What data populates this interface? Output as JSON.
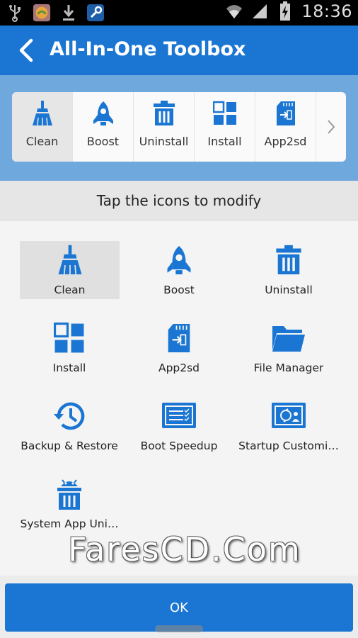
{
  "status_bar": {
    "time": "18:36"
  },
  "app_bar": {
    "title": "All-In-One Toolbox"
  },
  "toolbar_strip": [
    {
      "label": "Clean",
      "icon": "broom-icon"
    },
    {
      "label": "Boost",
      "icon": "rocket-icon"
    },
    {
      "label": "Uninstall",
      "icon": "trash-icon"
    },
    {
      "label": "Install",
      "icon": "apps-grid-icon"
    },
    {
      "label": "App2sd",
      "icon": "sd-card-icon"
    }
  ],
  "hint": "Tap the icons to modify",
  "tools": [
    {
      "label": "Clean",
      "icon": "broom-icon"
    },
    {
      "label": "Boost",
      "icon": "rocket-icon"
    },
    {
      "label": "Uninstall",
      "icon": "trash-icon"
    },
    {
      "label": "Install",
      "icon": "apps-grid-icon"
    },
    {
      "label": "App2sd",
      "icon": "sd-card-icon"
    },
    {
      "label": "File Manager",
      "icon": "folder-icon"
    },
    {
      "label": "Backup & Restore",
      "icon": "history-icon"
    },
    {
      "label": "Boot Speedup",
      "icon": "checklist-icon"
    },
    {
      "label": "Startup Customi…",
      "icon": "startup-icon"
    },
    {
      "label": "System App Uni…",
      "icon": "android-trash-icon"
    }
  ],
  "watermark": "FaresCD.Com",
  "ok_label": "OK",
  "colors": {
    "primary": "#1a76d2",
    "band": "#6fa8dc"
  }
}
